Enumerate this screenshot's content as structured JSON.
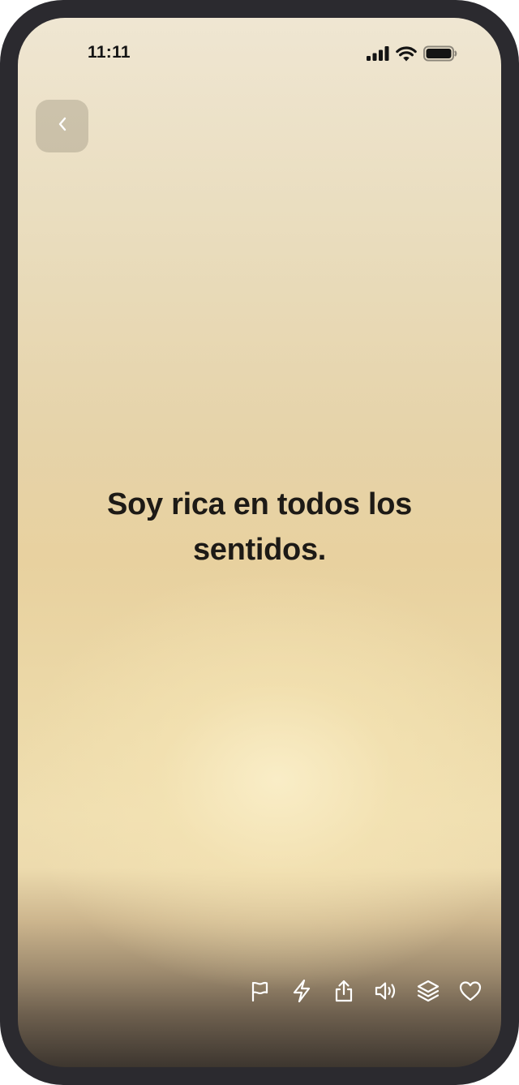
{
  "status_bar": {
    "time": "11:11",
    "icons": [
      "cellular-signal-icon",
      "wifi-icon",
      "battery-icon"
    ]
  },
  "navigation": {
    "back_icon": "chevron-left-icon"
  },
  "affirmation": {
    "text": "Soy rica en todos los sentidos."
  },
  "toolbar": {
    "icons": [
      "flag-icon",
      "lightning-icon",
      "share-icon",
      "speaker-icon",
      "layers-icon",
      "heart-icon"
    ]
  },
  "colors": {
    "frame": "#2b2a2f",
    "text": "#1d1a16",
    "icon_light": "#ffffff"
  }
}
